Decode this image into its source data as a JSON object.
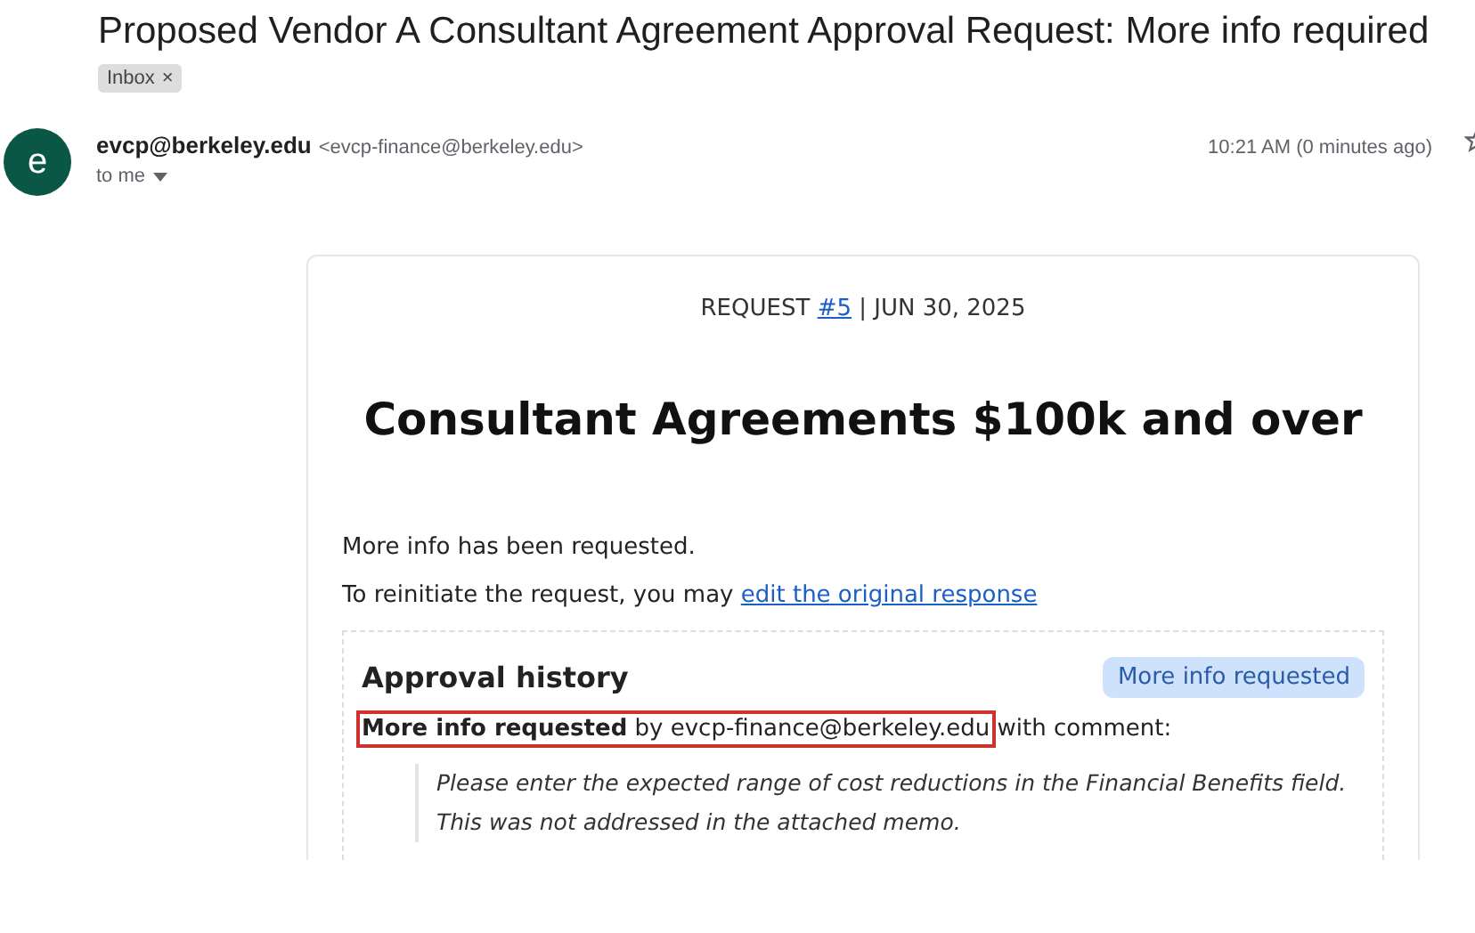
{
  "subject": "Proposed Vendor A Consultant Agreement Approval Request: More info required",
  "labels": [
    {
      "text": "Inbox",
      "remove": "×"
    }
  ],
  "sender": {
    "avatar": "e",
    "name": "evcp@berkeley.edu",
    "address": "<evcp-finance@berkeley.edu>",
    "time": "10:21 AM (0 minutes ago)",
    "to": "to me",
    "starred": false
  },
  "card": {
    "request_prefix": "REQUEST ",
    "request_link": "#5",
    "request_suffix": " | JUN 30, 2025",
    "title": "Consultant Agreements $100k and over",
    "message": "More info has been requested.",
    "reinitiate": "To reinitiate the request, you may ",
    "reinitiate_link": "edit the original response",
    "history": {
      "heading": "Approval history",
      "status": "More info requested",
      "highlighted": true,
      "entry_marked": "**More info requested** by evcp-finance@berkeley.edu",
      "entry_rest": " with comment:",
      "comment": "Please enter the expected range of cost reductions in the Financial Benefits field. This was not addressed in the attached memo."
    }
  }
}
